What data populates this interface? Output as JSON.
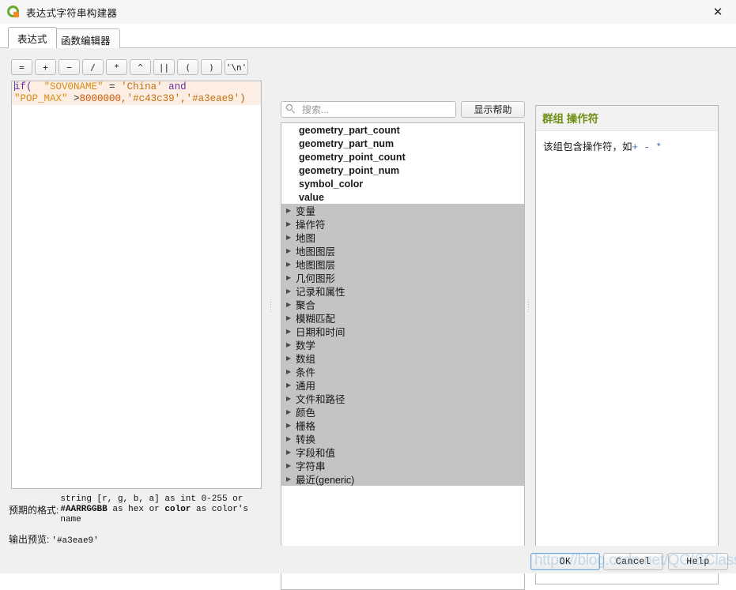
{
  "window": {
    "title": "表达式字符串构建器",
    "logo_icon": "qgis-logo-icon",
    "close_icon": "✕"
  },
  "tabs": [
    {
      "label": "表达式",
      "active": true
    },
    {
      "label": "函数编辑器",
      "active": false
    }
  ],
  "operators": [
    {
      "label": "="
    },
    {
      "label": "+"
    },
    {
      "label": "−"
    },
    {
      "label": "/"
    },
    {
      "label": "*"
    },
    {
      "label": "^"
    },
    {
      "label": "||"
    },
    {
      "label": "("
    },
    {
      "label": ")"
    },
    {
      "label": "'\\n'"
    }
  ],
  "expression": {
    "line1": {
      "fn": "if(",
      "space": "  ",
      "field": "\"SOV0NAME\"",
      "eq": " = ",
      "str": "'China'",
      "kw": " and"
    },
    "line2": {
      "field": "\"POP_MAX\"",
      "op": " >",
      "num": "8000000",
      "comma1": ",",
      "str1": "'#c43c39'",
      "comma2": ",",
      "str2": "'#a3eae9'",
      "close": ")"
    }
  },
  "format": {
    "label": "预期的格式:",
    "text_line1": "string [r, g, b, a] as int 0-255 or",
    "text_line2_a": "#AARRGGBB",
    "text_line2_b": " as hex or ",
    "text_line2_c": "color",
    "text_line2_d": " as color's",
    "text_line3": "name"
  },
  "preview": {
    "label": "输出预览:",
    "value": "'#a3eae9'"
  },
  "search": {
    "placeholder": "搜索...",
    "value": "",
    "icon": "search-icon"
  },
  "show_help_button": "显示帮助",
  "function_list": [
    "geometry_part_count",
    "geometry_part_num",
    "geometry_point_count",
    "geometry_point_num",
    "symbol_color",
    "value"
  ],
  "tree_groups": [
    "变量",
    "操作符",
    "地图",
    "地图图层",
    "地图图层",
    "几何图形",
    "记录和属性",
    "聚合",
    "模糊匹配",
    "日期和时间",
    "数学",
    "数组",
    "条件",
    "通用",
    "文件和路径",
    "颜色",
    "栅格",
    "转换",
    "字段和值",
    "字符串",
    "最近(generic)"
  ],
  "help_panel": {
    "heading": "群组 操作符",
    "body_prefix": "该组包含操作符，如",
    "body_symbols": "+ - *"
  },
  "dialog_buttons": {
    "ok": "OK",
    "cancel": "Cancel",
    "help": "Help"
  },
  "watermark": "https://blog.csdn.net/QGISClass",
  "colors": {
    "accent_green": "#63ac2f",
    "logo_orange": "#f08a1e",
    "help_heading": "#6f8f13",
    "expr_highlight_bg": "#fdeee3",
    "tree_selection": "#c4c4c4",
    "expr_color_a": "#c43c39",
    "expr_color_b": "#a3eae9"
  }
}
